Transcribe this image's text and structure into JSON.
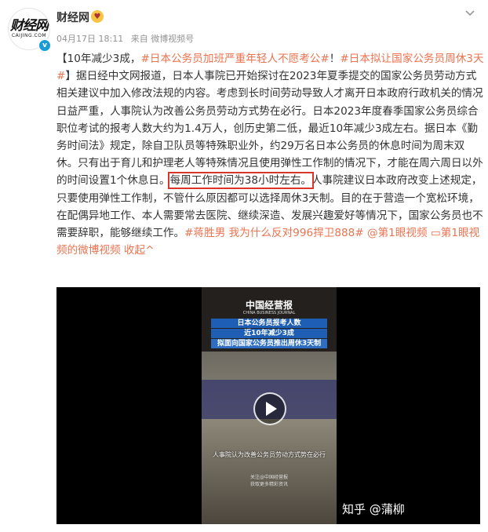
{
  "author": {
    "name": "财经网",
    "avatar_text": "财经网",
    "avatar_sub": "CAIJING.COM",
    "verified_mark": "v"
  },
  "meta": {
    "date": "04月17日 18:11",
    "source": "来自 微博视频号"
  },
  "post": {
    "p1": "【10年减少3成，",
    "tag1": "#日本公务员加班严重年轻人不愿考公#",
    "p2": "！",
    "tag2": "#日本拟让国家公务员周休3天#",
    "p3": "】据日经中文网报道，日本人事院已开始探讨在2023年夏季提交的国家公务员劳动方式相关建议中加入修改法规的内容。考虑到长时间劳动导致人才离开日本政府行政机关的情况日益严重，人事院认为改善公务员劳动方式势在必行。日本2023年度春季国家公务员综合职位考试的报考人数大约为1.4万人，创历史第二低，最近10年减少3成左右。据日本《勤务时间法》规定，除自卫队员等特殊职业外，约29万名日本公务员的休息时间为周末双休。只有出于育儿和护理老人等特殊情况且使用弹性工作制的情况下，才能在周六周日以外的时间设置1个休息日。",
    "highlight": "每周工作时间为38小时左右。",
    "p4": "人事院建议日本政府改变上述规定，只要使用弹性工作制，不管什么原因都可以选择周休3天制。目的在于营造一个宽松环境，在配偶异地工作、本人需要常去医院、继续深造、发展兴趣爱好等情况下，国家公务员也不需要辞职，能够继续工作。",
    "tag3": "#蒋胜男 我为什么反对996捍卫888#",
    "mention": "@第1眼视频",
    "video_link": "第1眼视频的微博视频",
    "collapse": "收起"
  },
  "video": {
    "brand": "中国经营报",
    "brand_sub": "CHINA BUSINESS JOURNAL",
    "cap1": "日本公务员报考人数",
    "cap2": "近10年减少3成",
    "cap3": "拟面向国家公务员推出周休3天制",
    "subtitle": "人事院认为改善公务员劳动方式势在必行",
    "foot1": "关注@中国经营报",
    "foot2": "获取更多精彩资讯"
  },
  "watermark": "知乎 @蒲柳"
}
